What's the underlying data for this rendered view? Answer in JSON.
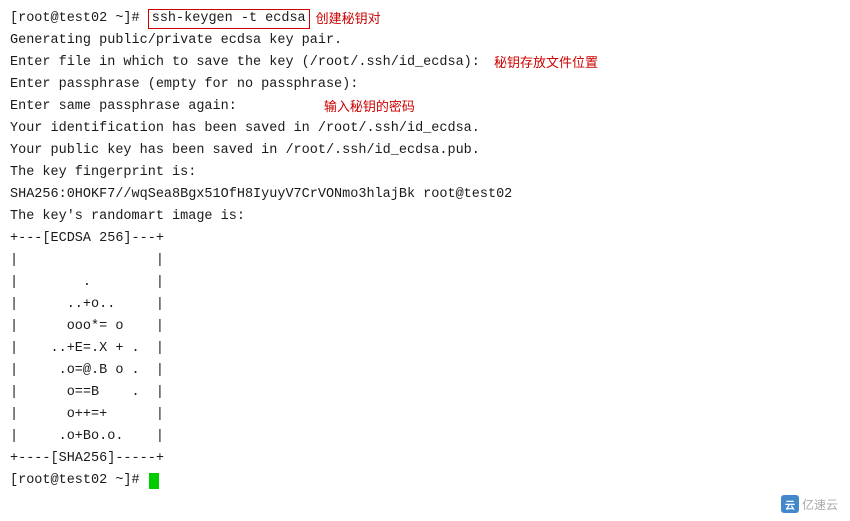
{
  "terminal": {
    "lines": [
      {
        "type": "prompt_command",
        "prompt": "[root@test02 ~]# ",
        "command": "ssh-keygen -t ecdsa",
        "annotation": "创建秘钥对",
        "annotation_arrow": true
      },
      {
        "type": "plain",
        "text": "Generating public/private ecdsa key pair."
      },
      {
        "type": "plain_annotation",
        "text": "Enter file in which to save the key (/root/.ssh/id_ecdsa): ",
        "annotation": "秘钥存放文件位置"
      },
      {
        "type": "plain",
        "text": "Enter passphrase (empty for no passphrase):"
      },
      {
        "type": "plain_annotation",
        "text": "Enter same passphrase again:",
        "annotation": "输入秘钥的密码",
        "annotation_space": "          "
      },
      {
        "type": "plain",
        "text": "Your identification has been saved in /root/.ssh/id_ecdsa."
      },
      {
        "type": "plain",
        "text": "Your public key has been saved in /root/.ssh/id_ecdsa.pub."
      },
      {
        "type": "plain",
        "text": "The key fingerprint is:"
      },
      {
        "type": "plain",
        "text": "SHA256:0HOKF7//wqSea8Bgx51OfH8IyuyV7CrVONmo3hlajBk root@test02"
      },
      {
        "type": "plain",
        "text": "The key's randomart image is:"
      },
      {
        "type": "plain",
        "text": "+---[ECDSA 256]---+"
      },
      {
        "type": "plain",
        "text": "|                 |"
      },
      {
        "type": "plain",
        "text": "|        .        |"
      },
      {
        "type": "plain",
        "text": "|      ..+o..     |"
      },
      {
        "type": "plain",
        "text": "|      ooo*= o    |"
      },
      {
        "type": "plain",
        "text": "|    ..+E=.X + .  |"
      },
      {
        "type": "plain",
        "text": "|     .o=@.B o .| "
      },
      {
        "type": "plain",
        "text": "|      o==B    .  |"
      },
      {
        "type": "plain",
        "text": "|      o++=+      |"
      },
      {
        "type": "plain",
        "text": "|     .o+Bo.o.    |"
      },
      {
        "type": "plain",
        "text": "+----[SHA256]-----+"
      },
      {
        "type": "prompt_cursor",
        "prompt": "[root@test02 ~]# "
      }
    ]
  },
  "watermark": {
    "text": "亿速云",
    "logo": "云"
  }
}
